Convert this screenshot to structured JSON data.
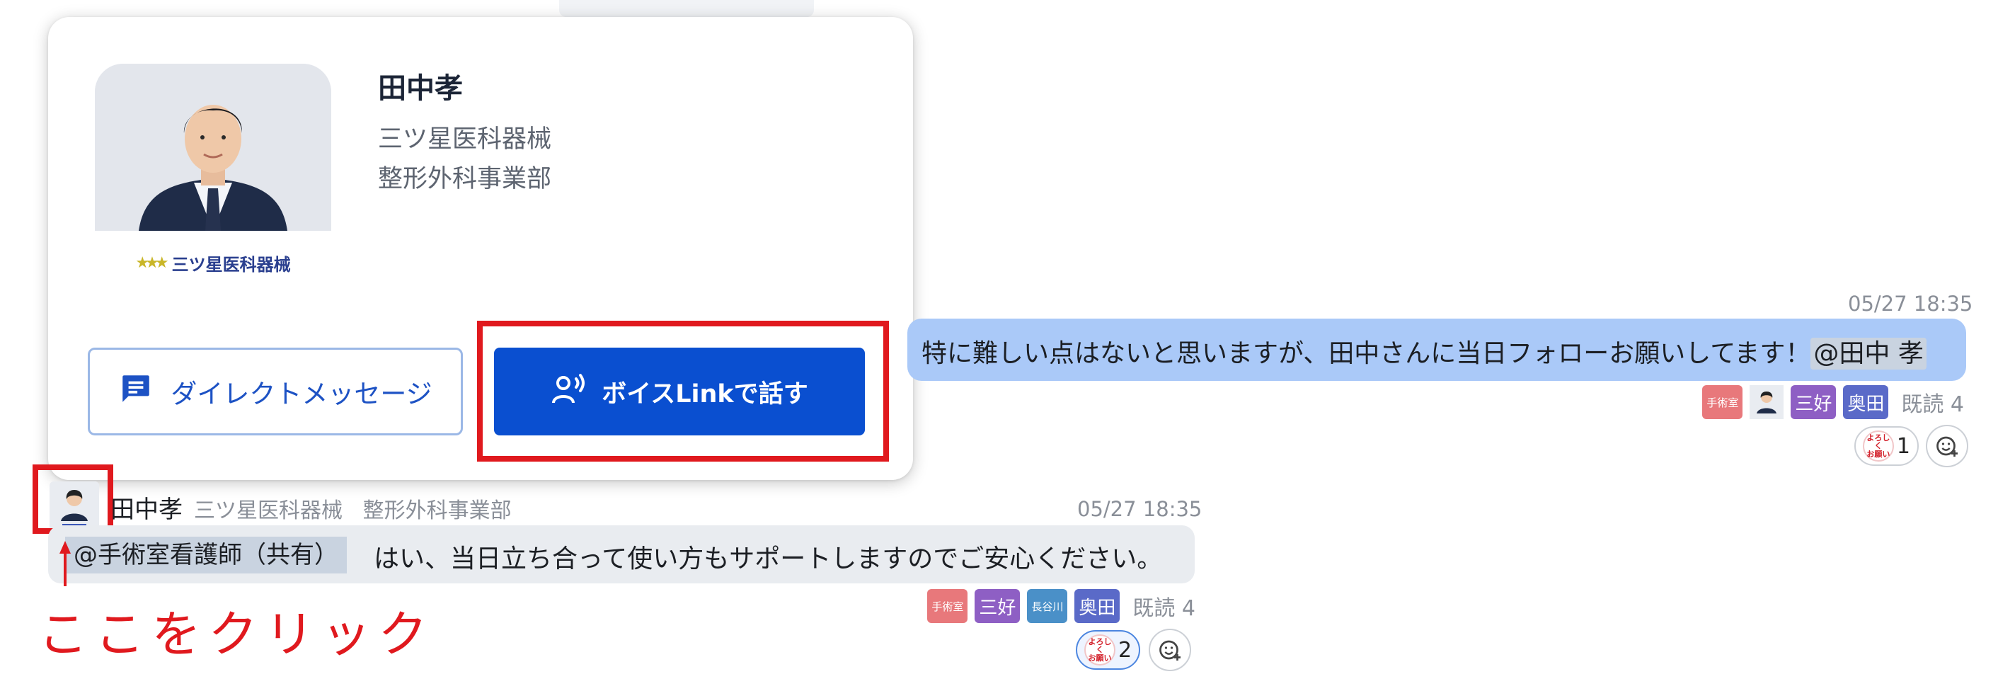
{
  "profile_card": {
    "name": "田中孝",
    "company": "三ツ星医科器械",
    "department": "整形外科事業部",
    "logo_text": "三ツ星医科器械",
    "dm_button": "ダイレクトメッセージ",
    "voice_button": "ボイスLinkで話す"
  },
  "message_out": {
    "timestamp": "05/27 18:35",
    "text": "特に難しい点はないと思いますが、田中さんに当日フォローお願いしてます！",
    "mention": "@田中 孝",
    "readers": [
      "手術室",
      "三好",
      "奥田"
    ],
    "read_label": "既読 4",
    "reaction_stamp": "よろしくお願いします",
    "reaction_count": "1"
  },
  "message_in": {
    "sender_name": "田中孝",
    "sender_company": "三ツ星医科器械",
    "sender_department": "整形外科事業部",
    "timestamp": "05/27 18:35",
    "mention": "@手術室看護師（共有）",
    "text": "はい、当日立ち合って使い方もサポートしますのでご安心ください。",
    "readers": [
      "手術室",
      "三好",
      "長谷川",
      "奥田"
    ],
    "read_label": "既読 4",
    "reaction_stamp": "よろしくお願いします",
    "reaction_count": "2"
  },
  "annotation": {
    "click_label": "ここをクリック"
  },
  "colors": {
    "accent_blue": "#0a4fd0",
    "highlight_red": "#e0191e",
    "outgoing_bubble": "#aac9f8",
    "incoming_bubble": "#e9ecf0",
    "badge_shujutsushitsu": "#e8787b",
    "badge_miyoshi": "#8e5fc4",
    "badge_hasegawa": "#4a90c8",
    "badge_okuda": "#5a6ac8"
  }
}
